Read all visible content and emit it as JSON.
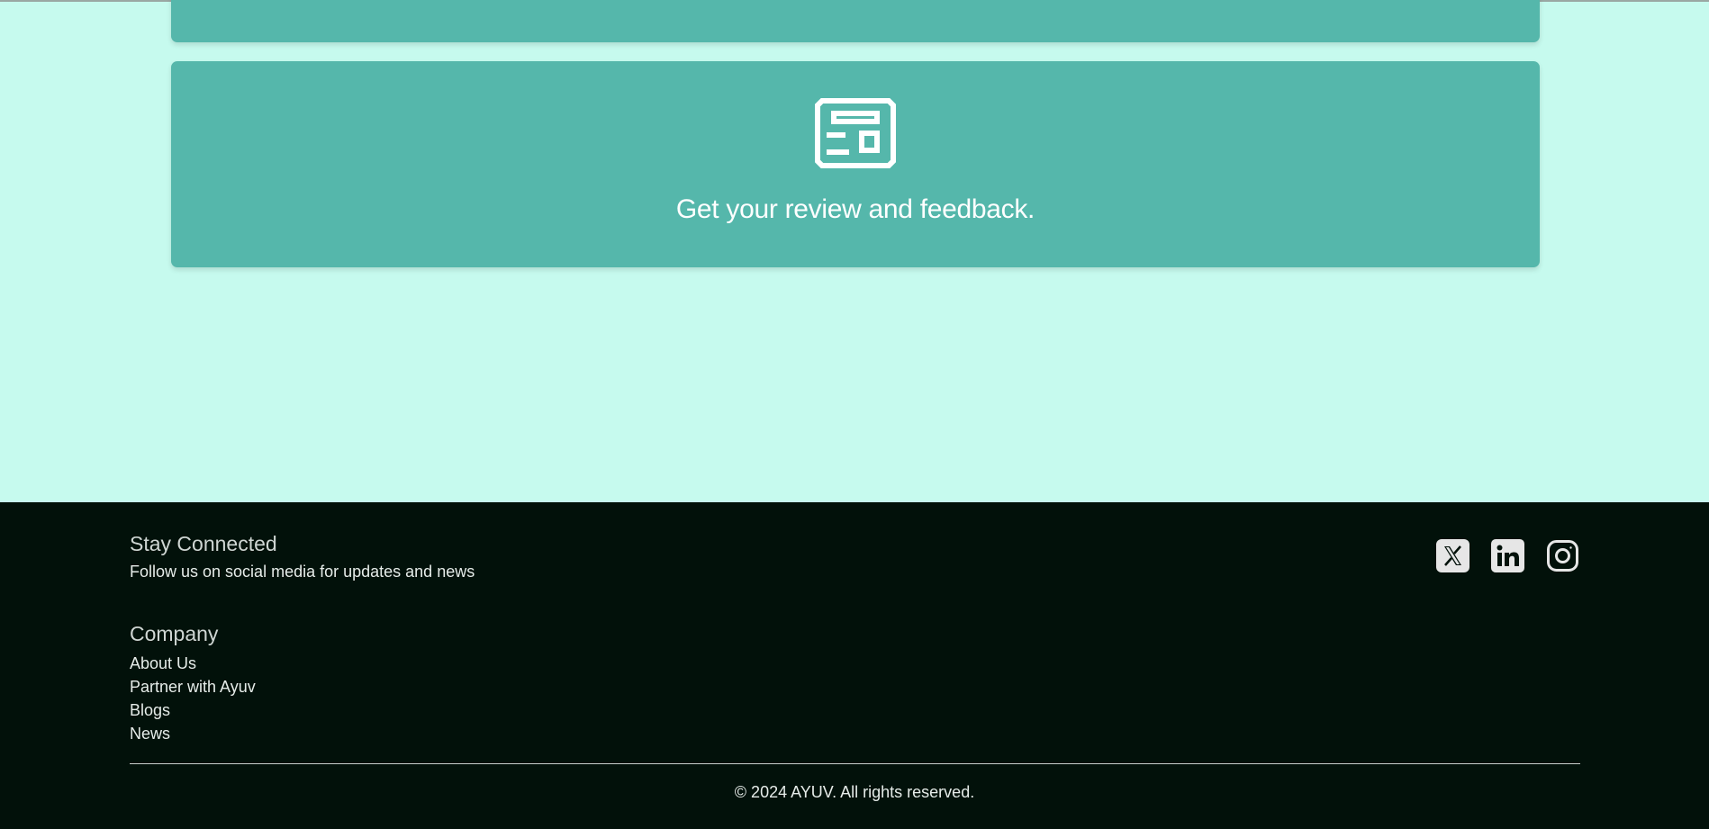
{
  "features": {
    "card_title": "Get your review and feedback.",
    "card_icon": "newspaper-icon"
  },
  "footer": {
    "stay_connected": {
      "title": "Stay Connected",
      "subtitle": "Follow us on social media for updates and news"
    },
    "company": {
      "title": "Company",
      "links": [
        "About Us",
        "Partner with Ayuv",
        "Blogs",
        "News"
      ]
    },
    "social_icons": [
      "x-twitter-icon",
      "linkedin-icon",
      "instagram-icon"
    ],
    "copyright": "© 2024 AYUV. All rights reserved."
  },
  "colors": {
    "page_bg": "#c6faee",
    "card_bg": "#55b7ab",
    "footer_bg": "#02110a"
  }
}
